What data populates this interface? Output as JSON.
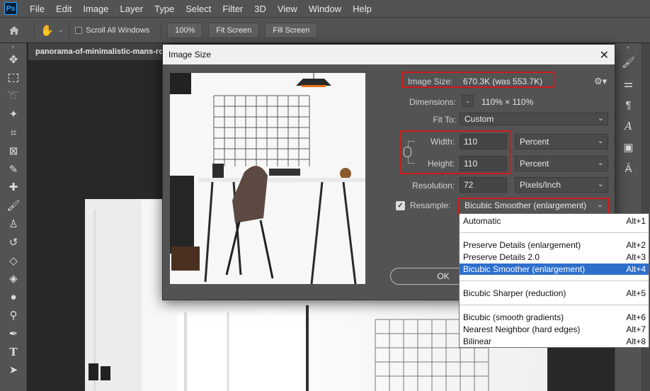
{
  "menubar": {
    "logo": "Ps",
    "items": [
      "File",
      "Edit",
      "Image",
      "Layer",
      "Type",
      "Select",
      "Filter",
      "3D",
      "View",
      "Window",
      "Help"
    ]
  },
  "options": {
    "scroll_all": "Scroll All Windows",
    "zoom": "100%",
    "fit_screen": "Fit Screen",
    "fill_screen": "Fill Screen"
  },
  "document": {
    "tab_title": "panorama-of-minimalistic-mans-ro"
  },
  "dialog": {
    "title": "Image Size",
    "image_size_label": "Image Size:",
    "image_size_value": "670.3K (was 553.7K)",
    "dimensions_label": "Dimensions:",
    "dimensions_value": "110%  ×  110%",
    "fit_to_label": "Fit To:",
    "fit_to_value": "Custom",
    "width_label": "Width:",
    "width_value": "110",
    "width_unit": "Percent",
    "height_label": "Height:",
    "height_value": "110",
    "height_unit": "Percent",
    "resolution_label": "Resolution:",
    "resolution_value": "72",
    "resolution_unit": "Pixels/Inch",
    "resample_label": "Resample:",
    "resample_value": "Bicubic Smoother (enlargement)",
    "ok_label": "OK"
  },
  "resample_options": [
    {
      "label": "Automatic",
      "shortcut": "Alt+1"
    },
    {
      "label": "Preserve Details (enlargement)",
      "shortcut": "Alt+2"
    },
    {
      "label": "Preserve Details 2.0",
      "shortcut": "Alt+3"
    },
    {
      "label": "Bicubic Smoother (enlargement)",
      "shortcut": "Alt+4"
    },
    {
      "label": "Bicubic Sharper (reduction)",
      "shortcut": "Alt+5"
    },
    {
      "label": "Bicubic (smooth gradients)",
      "shortcut": "Alt+6"
    },
    {
      "label": "Nearest Neighbor (hard edges)",
      "shortcut": "Alt+7"
    },
    {
      "label": "Bilinear",
      "shortcut": "Alt+8"
    }
  ],
  "colors": {
    "highlight": "#d11a1a",
    "selection": "#2e6fcc"
  }
}
